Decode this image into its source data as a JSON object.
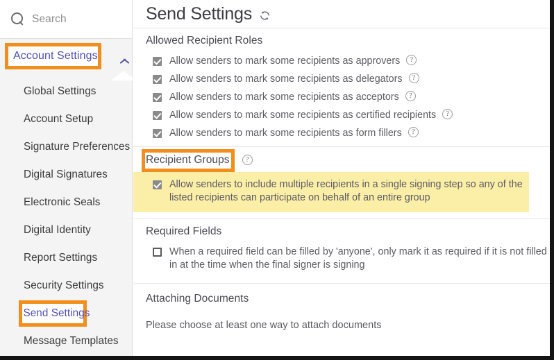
{
  "sidebar": {
    "search": {
      "placeholder": "Search",
      "icon": "search-icon"
    },
    "account_header": {
      "label": "Account Settings",
      "collapse_icon": "chevron-up-icon"
    },
    "items": [
      {
        "label": "Global Settings",
        "active": false
      },
      {
        "label": "Account Setup",
        "active": false
      },
      {
        "label": "Signature Preferences",
        "active": false
      },
      {
        "label": "Digital Signatures",
        "active": false
      },
      {
        "label": "Electronic Seals",
        "active": false
      },
      {
        "label": "Digital Identity",
        "active": false
      },
      {
        "label": "Report Settings",
        "active": false
      },
      {
        "label": "Security Settings",
        "active": false
      },
      {
        "label": "Send Settings",
        "active": true
      },
      {
        "label": "Message Templates",
        "active": false
      }
    ]
  },
  "main": {
    "title": "Send Settings",
    "refresh_icon": "refresh-icon",
    "sections": [
      {
        "id": "allowed-recipient-roles",
        "title": "Allowed Recipient Roles",
        "annotated": false,
        "help": null,
        "rows": [
          {
            "label": "Allow senders to mark some recipients as approvers",
            "checked": true,
            "help": true
          },
          {
            "label": "Allow senders to mark some recipients as delegators",
            "checked": true,
            "help": true
          },
          {
            "label": "Allow senders to mark some recipients as acceptors",
            "checked": true,
            "help": true
          },
          {
            "label": "Allow senders to mark some recipients as certified recipients",
            "checked": true,
            "help": true
          },
          {
            "label": "Allow senders to mark some recipients as form fillers",
            "checked": true,
            "help": true
          }
        ]
      },
      {
        "id": "recipient-groups",
        "title": "Recipient Groups",
        "annotated": true,
        "help": "?",
        "rows": [
          {
            "label": "Allow senders to include multiple recipients in a single signing step so any of the listed recipients can participate on behalf of an entire group",
            "checked": true,
            "help": false,
            "highlight": true
          }
        ]
      },
      {
        "id": "required-fields",
        "title": "Required Fields",
        "annotated": false,
        "help": null,
        "rows": [
          {
            "label": "When a required field can be filled by 'anyone', only mark it as required if it is not filled in at the time when the final signer is signing",
            "checked": false,
            "help": false
          }
        ]
      },
      {
        "id": "attaching-documents",
        "title": "Attaching Documents",
        "annotated": false,
        "help": null,
        "rows": [],
        "note": "Please choose at least one way to attach documents"
      }
    ]
  },
  "colors": {
    "annotation": "#f28f1c",
    "highlight": "#fbeea7",
    "link": "#4f4fbf",
    "sidebar_bg": "#f4f4f4",
    "text": "#5b5b63"
  }
}
